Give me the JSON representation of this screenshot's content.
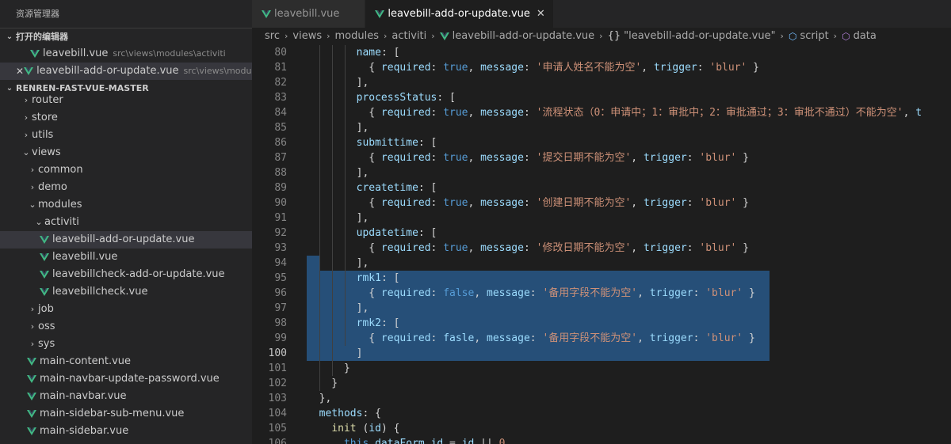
{
  "sidebar": {
    "title": "资源管理器",
    "open_editors": {
      "label": "打开的编辑器",
      "items": [
        {
          "name": "leavebill.vue",
          "path": "src\\views\\modules\\activiti"
        },
        {
          "name": "leavebill-add-or-update.vue",
          "path": "src\\views\\modul..."
        }
      ]
    },
    "project": {
      "label": "RENREN-FAST-VUE-MASTER",
      "items": [
        {
          "label": "router",
          "kind": "folder",
          "state": "collapsed"
        },
        {
          "label": "store",
          "kind": "folder",
          "state": "collapsed"
        },
        {
          "label": "utils",
          "kind": "folder",
          "state": "collapsed"
        },
        {
          "label": "views",
          "kind": "folder",
          "state": "expanded"
        },
        {
          "label": "common",
          "kind": "folder",
          "state": "collapsed"
        },
        {
          "label": "demo",
          "kind": "folder",
          "state": "collapsed"
        },
        {
          "label": "modules",
          "kind": "folder",
          "state": "expanded"
        },
        {
          "label": "activiti",
          "kind": "folder",
          "state": "expanded"
        },
        {
          "label": "leavebill-add-or-update.vue",
          "kind": "vue"
        },
        {
          "label": "leavebill.vue",
          "kind": "vue"
        },
        {
          "label": "leavebillcheck-add-or-update.vue",
          "kind": "vue"
        },
        {
          "label": "leavebillcheck.vue",
          "kind": "vue"
        },
        {
          "label": "job",
          "kind": "folder",
          "state": "collapsed"
        },
        {
          "label": "oss",
          "kind": "folder",
          "state": "collapsed"
        },
        {
          "label": "sys",
          "kind": "folder",
          "state": "collapsed"
        },
        {
          "label": "main-content.vue",
          "kind": "vue"
        },
        {
          "label": "main-navbar-update-password.vue",
          "kind": "vue"
        },
        {
          "label": "main-navbar.vue",
          "kind": "vue"
        },
        {
          "label": "main-sidebar-sub-menu.vue",
          "kind": "vue"
        },
        {
          "label": "main-sidebar.vue",
          "kind": "vue"
        }
      ]
    }
  },
  "tabs": [
    {
      "label": "leavebill.vue",
      "active": false
    },
    {
      "label": "leavebill-add-or-update.vue",
      "active": true
    }
  ],
  "breadcrumb": {
    "parts": [
      "src",
      "views",
      "modules",
      "activiti",
      "leavebill-add-or-update.vue",
      "\"leavebill-add-or-update.vue\"",
      "script",
      "data"
    ]
  },
  "colors": {
    "accent_vue": "#41b883",
    "selection": "#264f78",
    "string": "#ce9178",
    "keyword": "#569cd6",
    "property": "#9cdcfe"
  },
  "code": {
    "lines": [
      {
        "n": "80",
        "t": [
          [
            "        ",
            "p"
          ],
          [
            "name",
            "k"
          ],
          [
            ": [",
            "p"
          ]
        ]
      },
      {
        "n": "81",
        "t": [
          [
            "          { ",
            "p"
          ],
          [
            "required",
            "k"
          ],
          [
            ": ",
            "p"
          ],
          [
            "true",
            "b"
          ],
          [
            ", ",
            "p"
          ],
          [
            "message",
            "k"
          ],
          [
            ": ",
            "p"
          ],
          [
            "'申请人姓名不能为空'",
            "s"
          ],
          [
            ", ",
            "p"
          ],
          [
            "trigger",
            "k"
          ],
          [
            ": ",
            "p"
          ],
          [
            "'blur'",
            "s"
          ],
          [
            " }",
            "p"
          ]
        ]
      },
      {
        "n": "82",
        "t": [
          [
            "        ],",
            "p"
          ]
        ]
      },
      {
        "n": "83",
        "t": [
          [
            "        ",
            "p"
          ],
          [
            "processStatus",
            "k"
          ],
          [
            ": [",
            "p"
          ]
        ]
      },
      {
        "n": "84",
        "t": [
          [
            "          { ",
            "p"
          ],
          [
            "required",
            "k"
          ],
          [
            ": ",
            "p"
          ],
          [
            "true",
            "b"
          ],
          [
            ", ",
            "p"
          ],
          [
            "message",
            "k"
          ],
          [
            ": ",
            "p"
          ],
          [
            "'流程状态（0：申请中；1：审批中；2：审批通过；3：审批不通过）不能为空'",
            "s"
          ],
          [
            ", ",
            "p"
          ],
          [
            "t",
            "k"
          ]
        ]
      },
      {
        "n": "85",
        "t": [
          [
            "        ],",
            "p"
          ]
        ]
      },
      {
        "n": "86",
        "t": [
          [
            "        ",
            "p"
          ],
          [
            "submittime",
            "k"
          ],
          [
            ": [",
            "p"
          ]
        ]
      },
      {
        "n": "87",
        "t": [
          [
            "          { ",
            "p"
          ],
          [
            "required",
            "k"
          ],
          [
            ": ",
            "p"
          ],
          [
            "true",
            "b"
          ],
          [
            ", ",
            "p"
          ],
          [
            "message",
            "k"
          ],
          [
            ": ",
            "p"
          ],
          [
            "'提交日期不能为空'",
            "s"
          ],
          [
            ", ",
            "p"
          ],
          [
            "trigger",
            "k"
          ],
          [
            ": ",
            "p"
          ],
          [
            "'blur'",
            "s"
          ],
          [
            " }",
            "p"
          ]
        ]
      },
      {
        "n": "88",
        "t": [
          [
            "        ],",
            "p"
          ]
        ]
      },
      {
        "n": "89",
        "t": [
          [
            "        ",
            "p"
          ],
          [
            "createtime",
            "k"
          ],
          [
            ": [",
            "p"
          ]
        ]
      },
      {
        "n": "90",
        "t": [
          [
            "          { ",
            "p"
          ],
          [
            "required",
            "k"
          ],
          [
            ": ",
            "p"
          ],
          [
            "true",
            "b"
          ],
          [
            ", ",
            "p"
          ],
          [
            "message",
            "k"
          ],
          [
            ": ",
            "p"
          ],
          [
            "'创建日期不能为空'",
            "s"
          ],
          [
            ", ",
            "p"
          ],
          [
            "trigger",
            "k"
          ],
          [
            ": ",
            "p"
          ],
          [
            "'blur'",
            "s"
          ],
          [
            " }",
            "p"
          ]
        ]
      },
      {
        "n": "91",
        "t": [
          [
            "        ],",
            "p"
          ]
        ]
      },
      {
        "n": "92",
        "t": [
          [
            "        ",
            "p"
          ],
          [
            "updatetime",
            "k"
          ],
          [
            ": [",
            "p"
          ]
        ]
      },
      {
        "n": "93",
        "t": [
          [
            "          { ",
            "p"
          ],
          [
            "required",
            "k"
          ],
          [
            ": ",
            "p"
          ],
          [
            "true",
            "b"
          ],
          [
            ", ",
            "p"
          ],
          [
            "message",
            "k"
          ],
          [
            ": ",
            "p"
          ],
          [
            "'修改日期不能为空'",
            "s"
          ],
          [
            ", ",
            "p"
          ],
          [
            "trigger",
            "k"
          ],
          [
            ": ",
            "p"
          ],
          [
            "'blur'",
            "s"
          ],
          [
            " }",
            "p"
          ]
        ]
      },
      {
        "n": "94",
        "t": [
          [
            "        ],",
            "p"
          ]
        ]
      },
      {
        "n": "95",
        "t": [
          [
            "        ",
            "p"
          ],
          [
            "rmk1",
            "k"
          ],
          [
            ": [",
            "p"
          ]
        ]
      },
      {
        "n": "96",
        "t": [
          [
            "          { ",
            "p"
          ],
          [
            "required",
            "k"
          ],
          [
            ": ",
            "p"
          ],
          [
            "false",
            "b"
          ],
          [
            ", ",
            "p"
          ],
          [
            "message",
            "k"
          ],
          [
            ": ",
            "p"
          ],
          [
            "'备用字段不能为空'",
            "s"
          ],
          [
            ", ",
            "p"
          ],
          [
            "trigger",
            "k"
          ],
          [
            ": ",
            "p"
          ],
          [
            "'blur'",
            "s"
          ],
          [
            " }",
            "p"
          ]
        ]
      },
      {
        "n": "97",
        "t": [
          [
            "        ],",
            "p"
          ]
        ]
      },
      {
        "n": "98",
        "t": [
          [
            "        ",
            "p"
          ],
          [
            "rmk2",
            "k"
          ],
          [
            ": [",
            "p"
          ]
        ]
      },
      {
        "n": "99",
        "t": [
          [
            "          { ",
            "p"
          ],
          [
            "required",
            "k"
          ],
          [
            ": ",
            "p"
          ],
          [
            "fasle",
            "k"
          ],
          [
            ", ",
            "p"
          ],
          [
            "message",
            "k"
          ],
          [
            ": ",
            "p"
          ],
          [
            "'备用字段不能为空'",
            "s"
          ],
          [
            ", ",
            "p"
          ],
          [
            "trigger",
            "k"
          ],
          [
            ": ",
            "p"
          ],
          [
            "'blur'",
            "s"
          ],
          [
            " }",
            "p"
          ]
        ]
      },
      {
        "n": "100",
        "t": [
          [
            "        ]",
            "p"
          ]
        ]
      },
      {
        "n": "101",
        "t": [
          [
            "      }",
            "p"
          ]
        ]
      },
      {
        "n": "102",
        "t": [
          [
            "    }",
            "p"
          ]
        ]
      },
      {
        "n": "103",
        "t": [
          [
            "  },",
            "p"
          ]
        ]
      },
      {
        "n": "104",
        "t": [
          [
            "  ",
            "p"
          ],
          [
            "methods",
            "k"
          ],
          [
            ": {",
            "p"
          ]
        ]
      },
      {
        "n": "105",
        "t": [
          [
            "    ",
            "p"
          ],
          [
            "init",
            "f"
          ],
          [
            " (",
            "p"
          ],
          [
            "id",
            "k"
          ],
          [
            ") {",
            "p"
          ]
        ]
      },
      {
        "n": "106",
        "t": [
          [
            "      ",
            "p"
          ],
          [
            "this",
            "b"
          ],
          [
            ".",
            "p"
          ],
          [
            "dataForm",
            "k"
          ],
          [
            ".",
            "p"
          ],
          [
            "id",
            "k"
          ],
          [
            " = ",
            "p"
          ],
          [
            "id",
            "k"
          ],
          [
            " || ",
            "p"
          ],
          [
            "0",
            "s"
          ]
        ]
      }
    ],
    "current_line": "100"
  }
}
